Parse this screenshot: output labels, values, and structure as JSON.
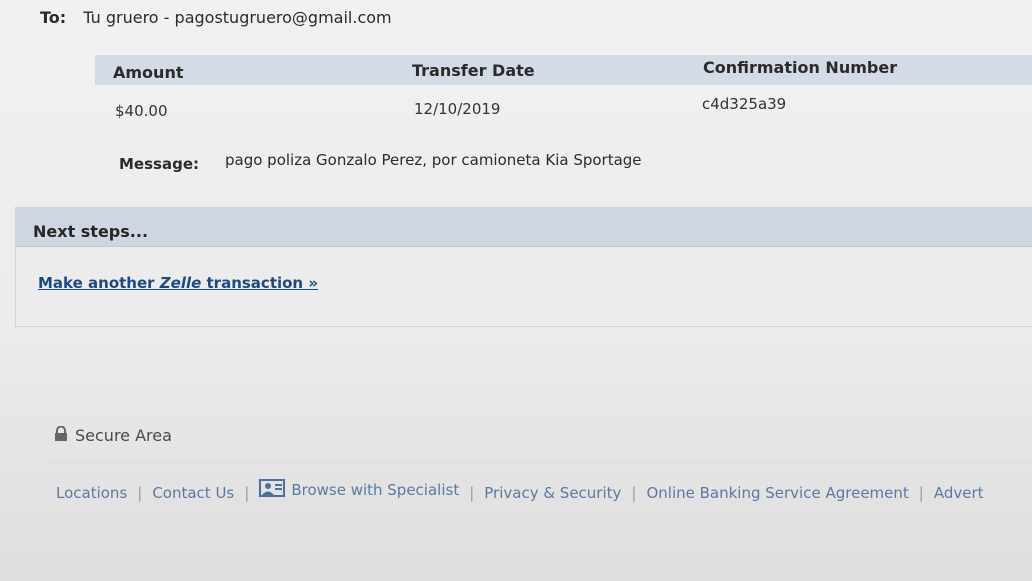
{
  "recipient": {
    "label": "To:",
    "value": "Tu gruero - pagostugruero@gmail.com"
  },
  "transfer_table": {
    "headers": [
      "Amount",
      "Transfer Date",
      "Confirmation Number"
    ],
    "row": [
      "$40.00",
      "12/10/2019",
      "c4d325a39"
    ]
  },
  "message": {
    "label": "Message:",
    "text": "pago poliza Gonzalo Perez, por camioneta Kia Sportage"
  },
  "next_steps": {
    "title": "Next steps...",
    "link_prefix": "Make another ",
    "link_brand": "Zelle",
    "link_suffix": " transaction »"
  },
  "secure_area": "Secure Area",
  "footer_links": {
    "locations": "Locations",
    "contact": "Contact Us",
    "browse": "Browse with Specialist",
    "privacy": "Privacy & Security",
    "agreement": "Online Banking Service Agreement",
    "advertising": "Advert"
  },
  "colors": {
    "link": "#1d4a83",
    "header_band": "#d3dbe6",
    "footer_link": "#5b79a3"
  },
  "icons": {
    "lock": "lock-icon",
    "specialist": "browse-specialist-icon"
  }
}
